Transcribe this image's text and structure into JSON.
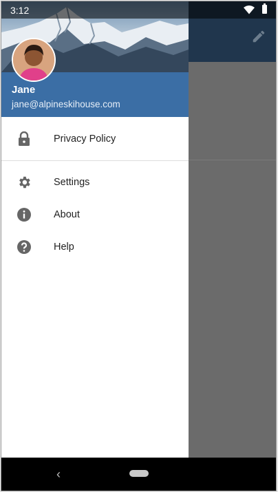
{
  "status_bar": {
    "time": "3:12"
  },
  "user": {
    "name": "Jane",
    "email": "jane@alpineskihouse.com"
  },
  "menu": {
    "primary": [
      {
        "label": "Privacy Policy",
        "icon": "lock-icon"
      }
    ],
    "secondary": [
      {
        "label": "Settings",
        "icon": "gear-icon"
      },
      {
        "label": "About",
        "icon": "info-icon"
      },
      {
        "label": "Help",
        "icon": "help-icon"
      }
    ]
  },
  "colors": {
    "drawer_header": "#3b6ea5",
    "toolbar": "#20364d",
    "scrim": "#6e6e6e",
    "icon": "#666666"
  }
}
